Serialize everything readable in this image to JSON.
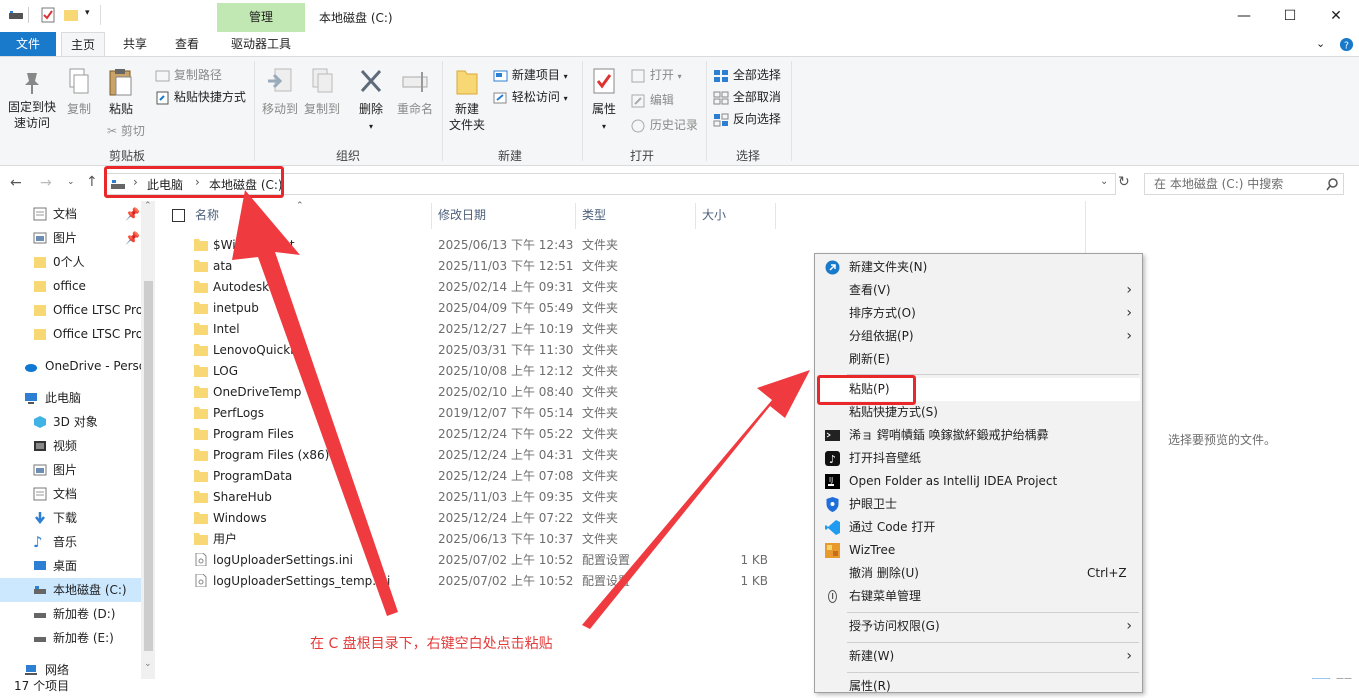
{
  "titlebar": {
    "manage_tab": "管理",
    "title": "本地磁盘 (C:)"
  },
  "ribbon_tabs": {
    "file": "文件",
    "home": "主页",
    "share": "共享",
    "view": "查看",
    "drive_tools": "驱动器工具"
  },
  "clipboard": {
    "pin_line1": "固定到快",
    "pin_line2": "速访问",
    "copy": "复制",
    "paste": "粘贴",
    "copy_path": "复制路径",
    "paste_shortcut": "粘贴快捷方式",
    "cut": "剪切",
    "label": "剪贴板"
  },
  "organize": {
    "move_to": "移动到",
    "copy_to": "复制到",
    "delete": "删除",
    "rename": "重命名",
    "label": "组织"
  },
  "new_group": {
    "new_folder_line1": "新建",
    "new_folder_line2": "文件夹",
    "new_item": "新建项目",
    "easy_access": "轻松访问",
    "label": "新建"
  },
  "open_group": {
    "properties": "属性",
    "open": "打开",
    "edit": "编辑",
    "history": "历史记录",
    "label": "打开"
  },
  "select_group": {
    "select_all": "全部选择",
    "select_none": "全部取消",
    "invert": "反向选择",
    "label": "选择"
  },
  "address": {
    "crumbs": [
      "此电脑",
      "本地磁盘 (C:)"
    ],
    "search_placeholder": "在 本地磁盘 (C:) 中搜索"
  },
  "nav": {
    "quick": [
      "文档",
      "图片",
      "0个人",
      "office",
      "Office LTSC Pro",
      "Office LTSC Pro"
    ],
    "onedrive": "OneDrive - Perso",
    "this_pc": "此电脑",
    "pc_items": [
      "3D 对象",
      "视频",
      "图片",
      "文档",
      "下载",
      "音乐",
      "桌面",
      "本地磁盘 (C:)",
      "新加卷 (D:)",
      "新加卷 (E:)"
    ],
    "network": "网络"
  },
  "columns": {
    "name": "名称",
    "date": "修改日期",
    "type": "类型",
    "size": "大小"
  },
  "files": [
    {
      "name": "$WinREAgent",
      "date": "2025/06/13 下午 12:43",
      "type": "文件夹",
      "size": ""
    },
    {
      "name": "ata",
      "date": "2025/11/03 下午 12:51",
      "type": "文件夹",
      "size": ""
    },
    {
      "name": "Autodesk",
      "date": "2025/02/14 上午 09:31",
      "type": "文件夹",
      "size": ""
    },
    {
      "name": "inetpub",
      "date": "2025/04/09 下午 05:49",
      "type": "文件夹",
      "size": ""
    },
    {
      "name": "Intel",
      "date": "2025/12/27 上午 10:19",
      "type": "文件夹",
      "size": ""
    },
    {
      "name": "LenovoQuickFix",
      "date": "2025/03/31 下午 11:30",
      "type": "文件夹",
      "size": ""
    },
    {
      "name": "LOG",
      "date": "2025/10/08 上午 12:12",
      "type": "文件夹",
      "size": ""
    },
    {
      "name": "OneDriveTemp",
      "date": "2025/02/10 上午 08:40",
      "type": "文件夹",
      "size": ""
    },
    {
      "name": "PerfLogs",
      "date": "2019/12/07 下午 05:14",
      "type": "文件夹",
      "size": ""
    },
    {
      "name": "Program Files",
      "date": "2025/12/24 下午 05:22",
      "type": "文件夹",
      "size": ""
    },
    {
      "name": "Program Files (x86)",
      "date": "2025/12/24 上午 04:31",
      "type": "文件夹",
      "size": ""
    },
    {
      "name": "ProgramData",
      "date": "2025/12/24 上午 07:08",
      "type": "文件夹",
      "size": ""
    },
    {
      "name": "ShareHub",
      "date": "2025/11/03 上午 09:35",
      "type": "文件夹",
      "size": ""
    },
    {
      "name": "Windows",
      "date": "2025/12/24 上午 07:22",
      "type": "文件夹",
      "size": ""
    },
    {
      "name": "用户",
      "date": "2025/06/13 下午 10:37",
      "type": "文件夹",
      "size": ""
    },
    {
      "name": "logUploaderSettings.ini",
      "date": "2025/07/02 上午 10:52",
      "type": "配置设置",
      "size": "1 KB"
    },
    {
      "name": "logUploaderSettings_temp.ini",
      "date": "2025/07/02 上午 10:52",
      "type": "配置设置",
      "size": "1 KB"
    }
  ],
  "preview_text": "选择要预览的文件。",
  "status": "17 个项目",
  "context_menu": {
    "new_folder": "新建文件夹(N)",
    "view": "查看(V)",
    "sort": "排序方式(O)",
    "group": "分组依据(P)",
    "refresh": "刷新(E)",
    "paste": "粘贴(P)",
    "paste_shortcut": "粘贴快捷方式(S)",
    "garbled": "浠ョ   鍔哨幘鍤   唤鎵撳紑鍛戒护绐楀彛",
    "douyin": "打开抖音壁纸",
    "intellij": "Open Folder as IntelliJ IDEA Project",
    "guard": "护眼卫士",
    "vscode": "通过 Code 打开",
    "wiztree": "WizTree",
    "undo_delete": "撤消 删除(U)",
    "undo_shortcut": "Ctrl+Z",
    "menu_manage": "右键菜单管理",
    "grant_access": "授予访问权限(G)",
    "new": "新建(W)",
    "properties": "属性(R)"
  },
  "annotation": "在 C 盘根目录下，右键空白处点击粘贴",
  "colors": {
    "accent": "#1979ca",
    "manage_green": "#c1e8b2",
    "annotation_red": "#e8282b",
    "folder": "#f8d775"
  }
}
